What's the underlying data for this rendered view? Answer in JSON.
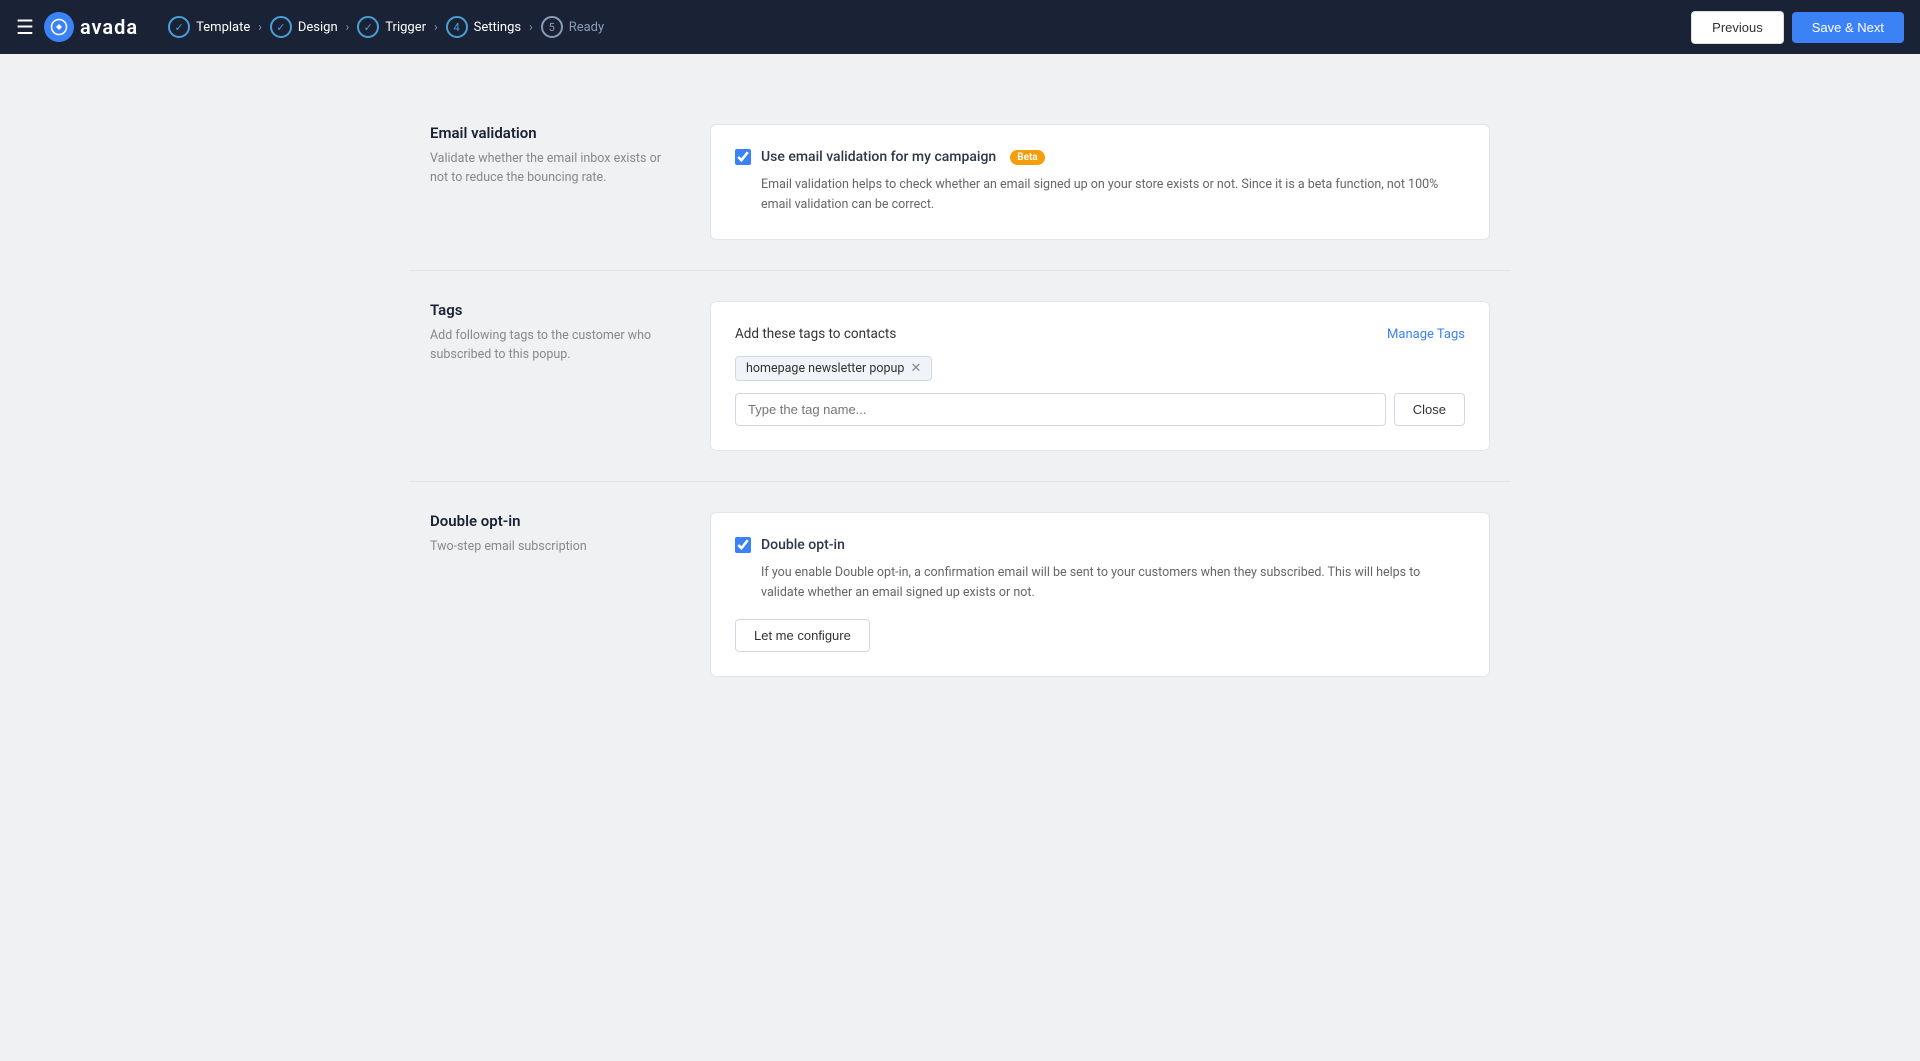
{
  "header": {
    "logo_text": "avada",
    "hamburger_label": "☰",
    "breadcrumb": [
      {
        "id": "template",
        "label": "Template",
        "type": "check",
        "step": null
      },
      {
        "id": "design",
        "label": "Design",
        "type": "check",
        "step": null
      },
      {
        "id": "trigger",
        "label": "Trigger",
        "type": "check",
        "step": null
      },
      {
        "id": "settings",
        "label": "Settings",
        "type": "number",
        "step": "4"
      },
      {
        "id": "ready",
        "label": "Ready",
        "type": "number",
        "step": "5"
      }
    ],
    "btn_previous": "Previous",
    "btn_save_next": "Save & Next"
  },
  "sections": {
    "email_validation": {
      "title": "Email validation",
      "description": "Validate whether the email inbox exists or not to reduce the bouncing rate.",
      "checkbox_label": "Use email validation for my campaign",
      "beta_badge": "Beta",
      "checked": true,
      "detail_text": "Email validation helps to check whether an email signed up on your store exists or not. Since it is a beta function, not 100% email validation can be correct."
    },
    "tags": {
      "title": "Tags",
      "description": "Add following tags to the customer who subscribed to this popup.",
      "header_label": "Add these tags to contacts",
      "manage_tags_label": "Manage Tags",
      "tag_chip_label": "homepage newsletter popup",
      "input_placeholder": "Type the tag name...",
      "btn_close_label": "Close"
    },
    "double_optin": {
      "title": "Double opt-in",
      "description": "Two-step email subscription",
      "checkbox_label": "Double opt-in",
      "checked": true,
      "detail_text": "If you enable Double opt-in, a confirmation email will be sent to your customers when they subscribed. This will helps to validate whether an email signed up exists or not.",
      "btn_configure_label": "Let me configure"
    }
  }
}
